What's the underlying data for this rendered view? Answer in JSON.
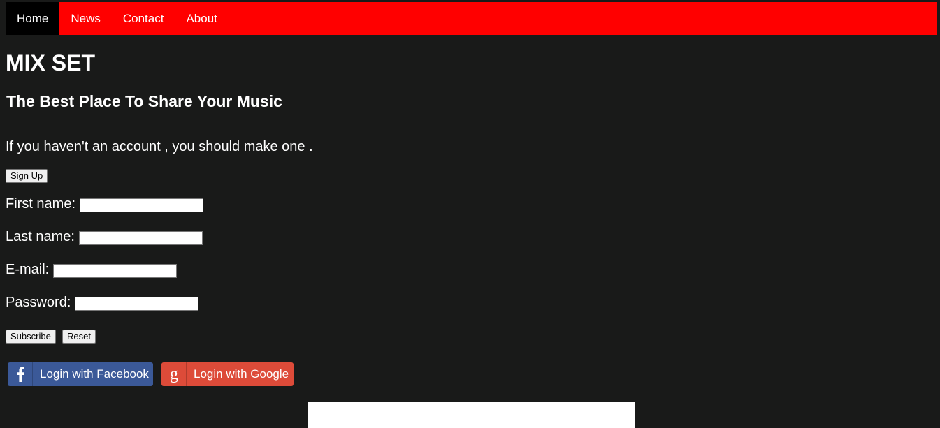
{
  "nav": {
    "items": [
      {
        "label": "Home"
      },
      {
        "label": "News"
      },
      {
        "label": "Contact"
      },
      {
        "label": "About"
      }
    ],
    "active": "Home"
  },
  "header": {
    "title": "MIX SET",
    "subtitle": "The Best Place To Share Your Music"
  },
  "signup": {
    "prompt": "If you haven't an account , you should make one .",
    "button_label": "Sign Up"
  },
  "form": {
    "first_name_label": "First name:",
    "first_name_value": "",
    "last_name_label": "Last name:",
    "last_name_value": "",
    "email_label": "E-mail:",
    "email_value": "",
    "password_label": "Password:",
    "password_value": "",
    "subscribe_label": "Subscribe",
    "reset_label": "Reset"
  },
  "social": {
    "facebook_label": "Login with Facebook",
    "facebook_color": "#3b5998",
    "facebook_icon": "facebook-icon",
    "google_label": "Login with Google",
    "google_color": "#dd4b39",
    "google_icon": "google-icon"
  },
  "colors": {
    "background": "#191a19",
    "navbar": "#ff0000",
    "nav_active": "#000000"
  }
}
